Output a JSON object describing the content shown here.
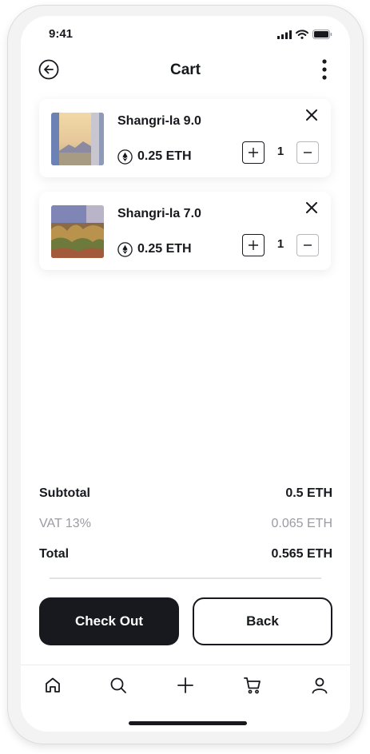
{
  "status_bar": {
    "time": "9:41"
  },
  "header": {
    "title": "Cart",
    "back_icon": "arrow-left-circle-icon",
    "more_icon": "more-vertical-icon"
  },
  "cart": {
    "currency_icon": "ethereum-icon",
    "items": [
      {
        "name": "Shangri-la 9.0",
        "price": "0.25 ETH",
        "quantity": "1"
      },
      {
        "name": "Shangri-la 7.0",
        "price": "0.25 ETH",
        "quantity": "1"
      }
    ]
  },
  "summary": {
    "subtotal_label": "Subtotal",
    "subtotal_value": "0.5 ETH",
    "vat_label": "VAT 13%",
    "vat_value": "0.065 ETH",
    "total_label": "Total",
    "total_value": "0.565 ETH"
  },
  "actions": {
    "checkout_label": "Check Out",
    "back_label": "Back"
  },
  "bottom_nav": [
    "home-icon",
    "search-icon",
    "plus-icon",
    "cart-icon",
    "user-icon"
  ],
  "colors": {
    "primary": "#17191e",
    "muted": "#9b9aa3",
    "background": "#ffffff"
  }
}
